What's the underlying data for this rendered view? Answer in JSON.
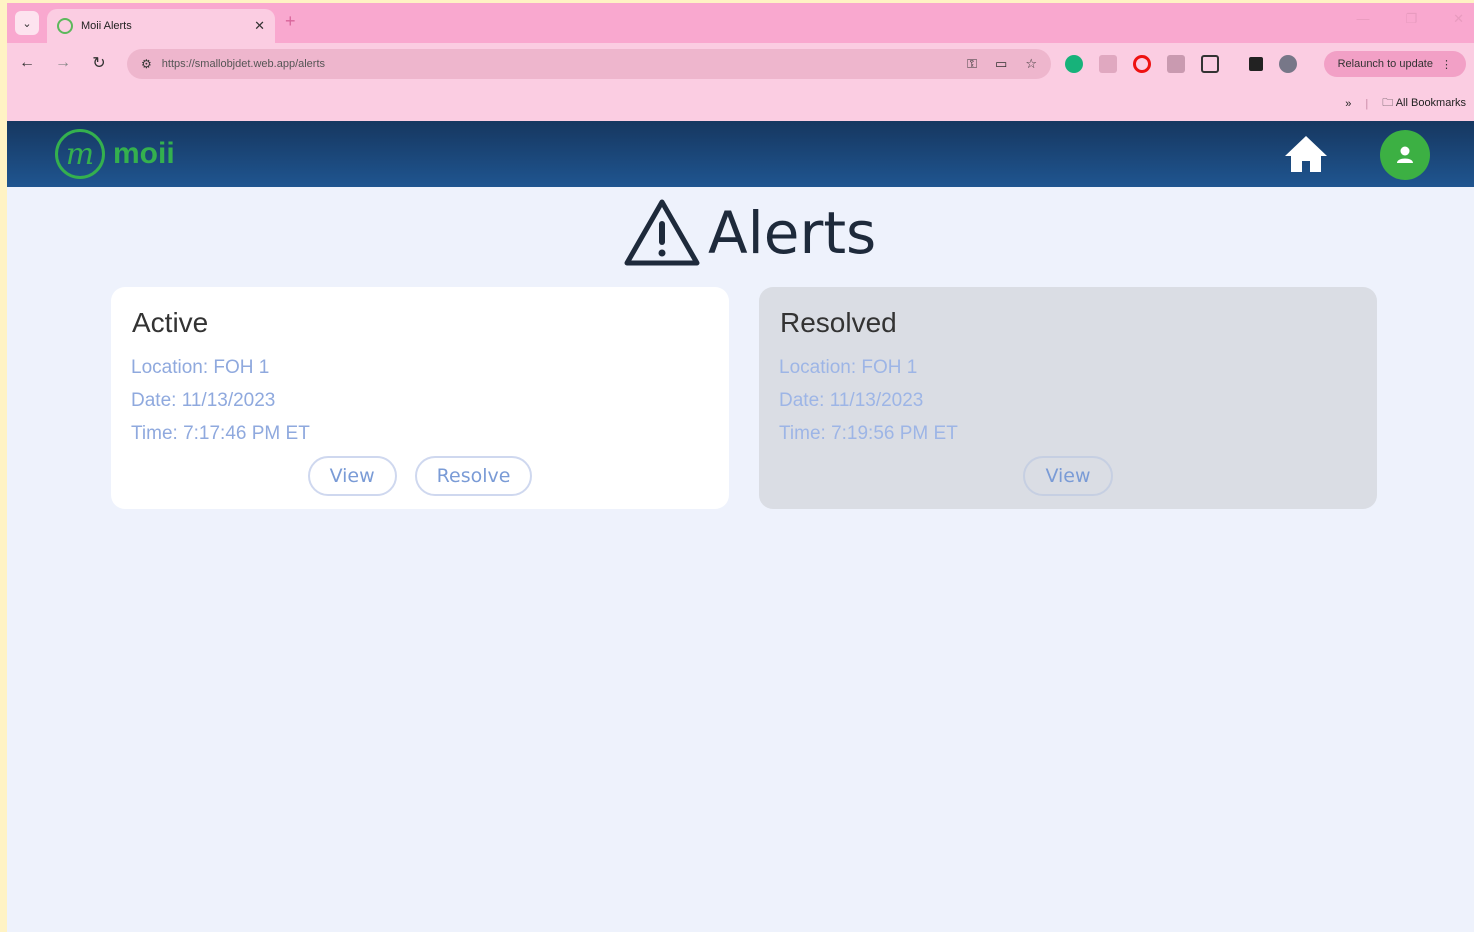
{
  "browser": {
    "tab_title": "Moii Alerts",
    "tab_close": "✕",
    "new_tab": "+",
    "url": "https://smallobjdet.web.app/alerts",
    "relaunch_label": "Relaunch to update",
    "bookmarks_label": "All Bookmarks",
    "chevron": "»"
  },
  "app": {
    "logo_mark": "m",
    "logo_text": "moii"
  },
  "page": {
    "title": "Alerts"
  },
  "alerts": [
    {
      "status": "Active",
      "location": "Location: FOH 1",
      "date": "Date: 11/13/2023",
      "time": "Time: 7:17:46 PM ET",
      "view_label": "View",
      "resolve_label": "Resolve"
    },
    {
      "status": "Resolved",
      "location": "Location: FOH 1",
      "date": "Date: 11/13/2023",
      "time": "Time: 7:19:56 PM ET",
      "view_label": "View"
    }
  ],
  "colors": {
    "header_top": "#163760",
    "header_bottom": "#1f5590",
    "brand_green": "#34b04e",
    "link_blue": "#8fa9de"
  }
}
